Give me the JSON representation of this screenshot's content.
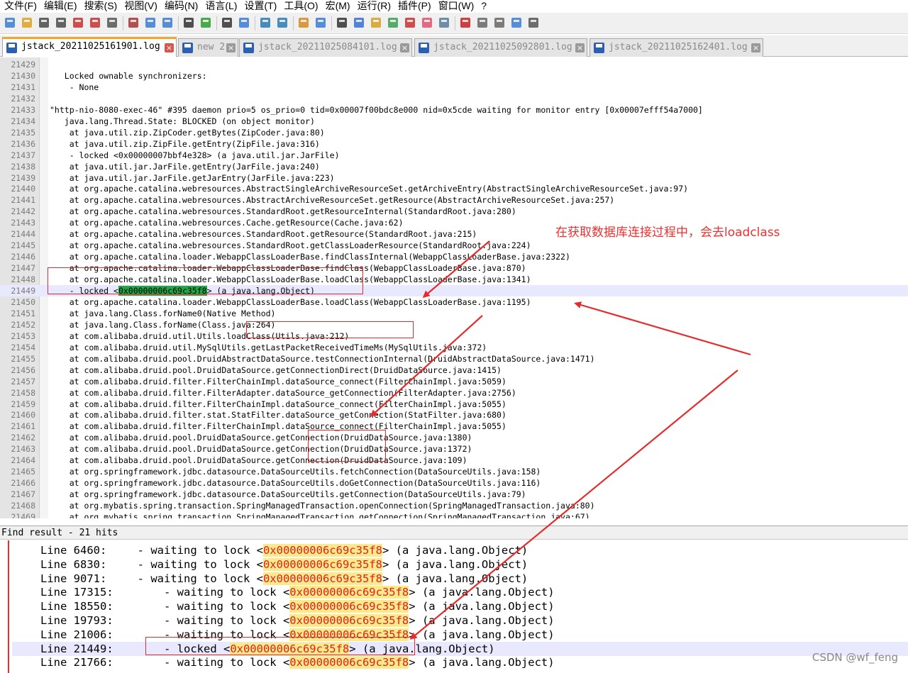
{
  "menu": [
    "文件(F)",
    "编辑(E)",
    "搜索(S)",
    "视图(V)",
    "编码(N)",
    "语言(L)",
    "设置(T)",
    "工具(O)",
    "宏(M)",
    "运行(R)",
    "插件(P)",
    "窗口(W)",
    "?"
  ],
  "toolbar_icons": [
    "new-file-icon",
    "open-file-icon",
    "save-icon",
    "save-all-icon",
    "close-icon",
    "close-all-icon",
    "print-icon",
    "cut-icon",
    "copy-icon",
    "paste-icon",
    "undo-icon",
    "redo-icon",
    "find-icon",
    "replace-icon",
    "zoom-in-icon",
    "zoom-out-icon",
    "sync-vertical-icon",
    "sync-horizontal-icon",
    "word-wrap-icon",
    "show-all-chars-icon",
    "indent-guide-icon",
    "doc-map-icon",
    "function-list-icon",
    "folder-workspace-icon",
    "monitoring-icon",
    "record-macro-icon",
    "stop-record-icon",
    "play-macro-icon",
    "run-macro-multiple-icon",
    "save-macro-icon"
  ],
  "tabs": [
    {
      "label": "jstack_20211025161901.log",
      "active": true
    },
    {
      "label": "new 2",
      "active": false
    },
    {
      "label": "jstack_20211025084101.log",
      "active": false
    },
    {
      "label": "jstack_20211025092801.log",
      "active": false
    },
    {
      "label": "jstack_20211025162401.log",
      "active": false
    }
  ],
  "editor_lines": [
    {
      "n": "21429",
      "t": ""
    },
    {
      "n": "21430",
      "t": "   Locked ownable synchronizers:"
    },
    {
      "n": "21431",
      "t": "    - None"
    },
    {
      "n": "21432",
      "t": ""
    },
    {
      "n": "21433",
      "t": "\"http-nio-8080-exec-46\" #395 daemon prio=5 os_prio=0 tid=0x00007f00bdc8e000 nid=0x5cde waiting for monitor entry [0x00007efff54a7000]"
    },
    {
      "n": "21434",
      "t": "   java.lang.Thread.State: BLOCKED (on object monitor)"
    },
    {
      "n": "21435",
      "t": "    at java.util.zip.ZipCoder.getBytes(ZipCoder.java:80)"
    },
    {
      "n": "21436",
      "t": "    at java.util.zip.ZipFile.getEntry(ZipFile.java:316)"
    },
    {
      "n": "21437",
      "t": "    - locked <0x00000007bbf4e328> (a java.util.jar.JarFile)"
    },
    {
      "n": "21438",
      "t": "    at java.util.jar.JarFile.getEntry(JarFile.java:240)"
    },
    {
      "n": "21439",
      "t": "    at java.util.jar.JarFile.getJarEntry(JarFile.java:223)"
    },
    {
      "n": "21440",
      "t": "    at org.apache.catalina.webresources.AbstractSingleArchiveResourceSet.getArchiveEntry(AbstractSingleArchiveResourceSet.java:97)"
    },
    {
      "n": "21441",
      "t": "    at org.apache.catalina.webresources.AbstractArchiveResourceSet.getResource(AbstractArchiveResourceSet.java:257)"
    },
    {
      "n": "21442",
      "t": "    at org.apache.catalina.webresources.StandardRoot.getResourceInternal(StandardRoot.java:280)"
    },
    {
      "n": "21443",
      "t": "    at org.apache.catalina.webresources.Cache.getResource(Cache.java:62)"
    },
    {
      "n": "21444",
      "t": "    at org.apache.catalina.webresources.StandardRoot.getResource(StandardRoot.java:215)"
    },
    {
      "n": "21445",
      "t": "    at org.apache.catalina.webresources.StandardRoot.getClassLoaderResource(StandardRoot.java:224)"
    },
    {
      "n": "21446",
      "t": "    at org.apache.catalina.loader.WebappClassLoaderBase.findClassInternal(WebappClassLoaderBase.java:2322)"
    },
    {
      "n": "21447",
      "t": "    at org.apache.catalina.loader.WebappClassLoaderBase.findClass(WebappClassLoaderBase.java:870)"
    },
    {
      "n": "21448",
      "t": "    at org.apache.catalina.loader.WebappClassLoaderBase.loadClass(WebappClassLoaderBase.java:1341)"
    },
    {
      "n": "21449",
      "pre": "    - locked <",
      "hl": "0x00000006c69c35f8",
      "post": "> (a java.lang.Object)"
    },
    {
      "n": "21450",
      "t": "    at org.apache.catalina.loader.WebappClassLoaderBase.loadClass(WebappClassLoaderBase.java:1195)"
    },
    {
      "n": "21451",
      "t": "    at java.lang.Class.forName0(Native Method)"
    },
    {
      "n": "21452",
      "t": "    at java.lang.Class.forName(Class.java:264)"
    },
    {
      "n": "21453",
      "t": "    at com.alibaba.druid.util.Utils.loadClass(Utils.java:212)"
    },
    {
      "n": "21454",
      "t": "    at com.alibaba.druid.util.MySqlUtils.getLastPacketReceivedTimeMs(MySqlUtils.java:372)"
    },
    {
      "n": "21455",
      "t": "    at com.alibaba.druid.pool.DruidAbstractDataSource.testConnectionInternal(DruidAbstractDataSource.java:1471)"
    },
    {
      "n": "21456",
      "t": "    at com.alibaba.druid.pool.DruidDataSource.getConnectionDirect(DruidDataSource.java:1415)"
    },
    {
      "n": "21457",
      "t": "    at com.alibaba.druid.filter.FilterChainImpl.dataSource_connect(FilterChainImpl.java:5059)"
    },
    {
      "n": "21458",
      "t": "    at com.alibaba.druid.filter.FilterAdapter.dataSource_getConnection(FilterAdapter.java:2756)"
    },
    {
      "n": "21459",
      "t": "    at com.alibaba.druid.filter.FilterChainImpl.dataSource_connect(FilterChainImpl.java:5055)"
    },
    {
      "n": "21460",
      "t": "    at com.alibaba.druid.filter.stat.StatFilter.dataSource_getConnection(StatFilter.java:680)"
    },
    {
      "n": "21461",
      "t": "    at com.alibaba.druid.filter.FilterChainImpl.dataSource_connect(FilterChainImpl.java:5055)"
    },
    {
      "n": "21462",
      "t": "    at com.alibaba.druid.pool.DruidDataSource.getConnection(DruidDataSource.java:1380)"
    },
    {
      "n": "21463",
      "t": "    at com.alibaba.druid.pool.DruidDataSource.getConnection(DruidDataSource.java:1372)"
    },
    {
      "n": "21464",
      "t": "    at com.alibaba.druid.pool.DruidDataSource.getConnection(DruidDataSource.java:109)"
    },
    {
      "n": "21465",
      "t": "    at org.springframework.jdbc.datasource.DataSourceUtils.fetchConnection(DataSourceUtils.java:158)"
    },
    {
      "n": "21466",
      "t": "    at org.springframework.jdbc.datasource.DataSourceUtils.doGetConnection(DataSourceUtils.java:116)"
    },
    {
      "n": "21467",
      "t": "    at org.springframework.jdbc.datasource.DataSourceUtils.getConnection(DataSourceUtils.java:79)"
    },
    {
      "n": "21468",
      "t": "    at org.mybatis.spring.transaction.SpringManagedTransaction.openConnection(SpringManagedTransaction.java:80)"
    },
    {
      "n": "21469",
      "t": "    at org.mybatis.spring.transaction.SpringManagedTransaction.getConnection(SpringManagedTransaction.java:67)"
    }
  ],
  "current_line": "21449",
  "find_result": {
    "header": "Find result - 21 hits",
    "rows": [
      {
        "line": "Line 6460:",
        "pre": "  - waiting to lock <",
        "hl": "0x00000006c69c35f8",
        "post": "> (a java.lang.Object)"
      },
      {
        "line": "Line 6830:",
        "pre": "  - waiting to lock <",
        "hl": "0x00000006c69c35f8",
        "post": "> (a java.lang.Object)"
      },
      {
        "line": "Line 9071:",
        "pre": "  - waiting to lock <",
        "hl": "0x00000006c69c35f8",
        "post": "> (a java.lang.Object)"
      },
      {
        "line": "Line 17315:",
        "pre": "      - waiting to lock <",
        "hl": "0x00000006c69c35f8",
        "post": "> (a java.lang.Object)"
      },
      {
        "line": "Line 18550:",
        "pre": "      - waiting to lock <",
        "hl": "0x00000006c69c35f8",
        "post": "> (a java.lang.Object)"
      },
      {
        "line": "Line 19793:",
        "pre": "      - waiting to lock <",
        "hl": "0x00000006c69c35f8",
        "post": "> (a java.lang.Object)"
      },
      {
        "line": "Line 21006:",
        "pre": "      - waiting to lock <",
        "hl": "0x00000006c69c35f8",
        "post": "> (a java.lang.Object)"
      },
      {
        "line": "Line 21449:",
        "pre": "      - locked <",
        "hl": "0x00000006c69c35f8",
        "post": "> (a java.lang.Object)",
        "current": true
      },
      {
        "line": "Line 21766:",
        "pre": "      - waiting to lock <",
        "hl": "0x00000006c69c35f8",
        "post": "> (a java.lang.Object)"
      }
    ]
  },
  "annotation": "在获取数据库连接过程中，会去loadclass",
  "watermark": "CSDN @wf_feng",
  "colors": {
    "annotation_red": "#e52b2b",
    "match_green": "#1fa845",
    "find_highlight_bg": "#fce98a",
    "find_highlight_fg": "#e02020"
  }
}
